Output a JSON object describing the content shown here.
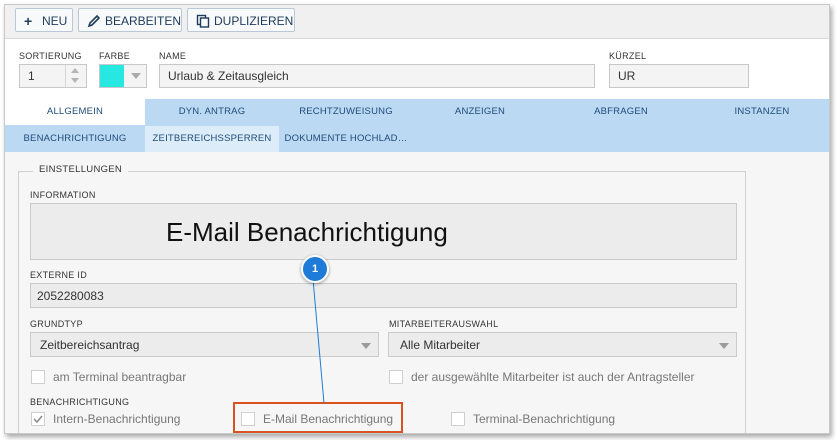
{
  "toolbar": {
    "new_label": "NEU",
    "edit_label": "BEARBEITEN",
    "duplicate_label": "DUPLIZIEREN"
  },
  "header": {
    "sortierung_label": "SORTIERUNG",
    "sortierung_value": "1",
    "farbe_label": "FARBE",
    "farbe_value": "#27e8e0",
    "name_label": "NAME",
    "name_value": "Urlaub & Zeitausgleich",
    "kuerzel_label": "KÜRZEL",
    "kuerzel_value": "UR"
  },
  "tabs": {
    "row1": [
      "ALLGEMEIN",
      "DYN. ANTRAG",
      "RECHTZUWEISUNG",
      "ANZEIGEN",
      "ABFRAGEN",
      "INSTANZEN"
    ],
    "row2": [
      "BENACHRICHTIGUNG",
      "ZEITBEREICHSSPERREN",
      "DOKUMENTE HOCHLAD…"
    ],
    "active": "ALLGEMEIN"
  },
  "settings": {
    "group_title": "EINSTELLUNGEN",
    "information_label": "INFORMATION",
    "information_text": "E-Mail Benachrichtigung",
    "externe_id_label": "EXTERNE ID",
    "externe_id_value": "2052280083",
    "grundtyp_label": "GRUNDTYP",
    "grundtyp_value": "Zeitbereichsantrag",
    "mitarbeiterauswahl_label": "MITARBEITERAUSWAHL",
    "mitarbeiterauswahl_value": "Alle Mitarbeiter",
    "terminal_label": "am Terminal beantragbar",
    "antragsteller_label": "der ausgewählte Mitarbeiter ist auch der Antragsteller",
    "benachrichtigung_label": "BENACHRICHTIGUNG",
    "intern_label": "Intern-Benachrichtigung",
    "intern_checked": true,
    "email_label": "E-Mail Benachrichtigung",
    "email_checked": false,
    "terminal_benach_label": "Terminal-Benachrichtigung",
    "terminal_benach_checked": false
  },
  "callout": {
    "number": "1",
    "color": "#1e7bd8",
    "highlight_color": "#d9531e"
  }
}
